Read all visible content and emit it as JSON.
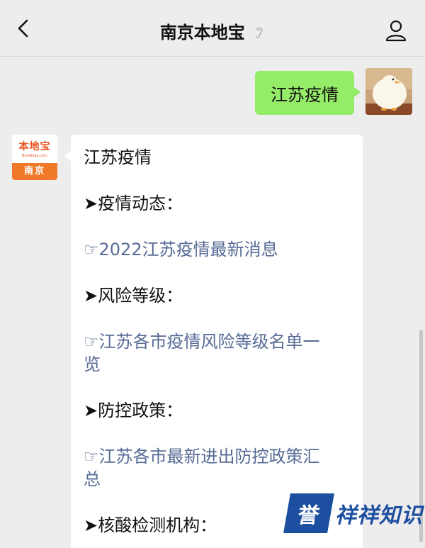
{
  "header": {
    "title": "南京本地宝"
  },
  "outgoing_message": {
    "text": "江苏疫情"
  },
  "bot_avatar": {
    "brand": "本地宝",
    "url": "Bendibao.com",
    "city": "南京"
  },
  "incoming_message": {
    "lines": [
      "江苏疫情",
      "➤疫情动态：",
      "☞2022江苏疫情最新消息",
      "➤风险等级：",
      "☞江苏各市疫情风险等级名单一",
      "览",
      "➤防控政策：",
      "☞江苏各市最新进出防控政策汇",
      "总",
      "➤核酸检测机构："
    ]
  },
  "watermark": {
    "badge": "誉",
    "text": "祥祥知识"
  },
  "colors": {
    "outgoing_bubble": "#95ec69",
    "link": "#576b95",
    "brand_orange": "#f07a2a",
    "watermark_blue": "#1c4fa0"
  }
}
